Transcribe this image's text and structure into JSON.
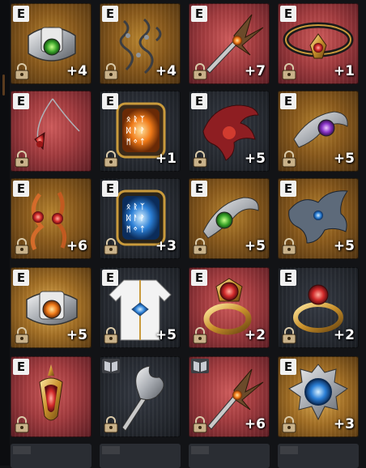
{
  "inventory": {
    "items": [
      {
        "name": "silver-gem-bracer",
        "tag": "E",
        "level": "+4",
        "bg": "gold"
      },
      {
        "name": "dark-filigree-earrings",
        "tag": "E",
        "level": "+4",
        "bg": "gold"
      },
      {
        "name": "spiked-dagger",
        "tag": "E",
        "level": "+7",
        "bg": "red"
      },
      {
        "name": "red-choker",
        "tag": "E",
        "level": "+1",
        "bg": "red"
      },
      {
        "name": "crimson-necklace",
        "tag": "E",
        "level": "",
        "bg": "red"
      },
      {
        "name": "amber-rune-tablet",
        "tag": "E",
        "level": "+1",
        "bg": "dark"
      },
      {
        "name": "red-wing-emblem",
        "tag": "E",
        "level": "+5",
        "bg": "dark"
      },
      {
        "name": "purple-gem-brooch",
        "tag": "E",
        "level": "+5",
        "bg": "gold"
      },
      {
        "name": "flame-earrings",
        "tag": "E",
        "level": "+6",
        "bg": "gold"
      },
      {
        "name": "blue-rune-tablet",
        "tag": "E",
        "level": "+3",
        "bg": "dark"
      },
      {
        "name": "green-gem-brooch",
        "tag": "E",
        "level": "+5",
        "bg": "gold"
      },
      {
        "name": "wyvern-emblem",
        "tag": "E",
        "level": "+5",
        "bg": "gold"
      },
      {
        "name": "orange-gem-bracer",
        "tag": "E",
        "level": "+5",
        "bg": "gold2"
      },
      {
        "name": "white-robe",
        "tag": "E",
        "level": "+5",
        "bg": "dark"
      },
      {
        "name": "ruby-ring",
        "tag": "E",
        "level": "+2",
        "bg": "red"
      },
      {
        "name": "garnet-ring",
        "tag": "E",
        "level": "+2",
        "bg": "dark"
      },
      {
        "name": "ruby-pendant",
        "tag": "E",
        "level": "",
        "bg": "red"
      },
      {
        "name": "silver-scepter",
        "tag": "",
        "level": "",
        "bg": "dark",
        "book": true
      },
      {
        "name": "spiked-dagger-2",
        "tag": "",
        "level": "+6",
        "bg": "red",
        "book": true
      },
      {
        "name": "sapphire-amulet",
        "tag": "E",
        "level": "+3",
        "bg": "gold2"
      }
    ]
  }
}
